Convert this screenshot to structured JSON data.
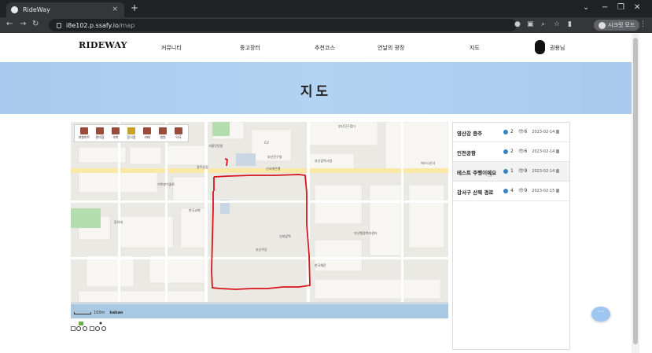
{
  "browser": {
    "tab_title": "RideWay",
    "tab_close": "×",
    "new_tab": "+",
    "url_host": "i8e102.p.ssafy.io",
    "url_path": "/map",
    "profile_label": "시크릿 모드",
    "window_controls": [
      "⌄",
      "−",
      "❐",
      "✕"
    ]
  },
  "header": {
    "logo": "RIDEWAY",
    "nav": [
      "커뮤니티",
      "중고장터",
      "추천코스",
      "연날의 광장",
      "지도"
    ],
    "username": "권용님"
  },
  "banner": {
    "title": "지도"
  },
  "map": {
    "toolbar": [
      "대형마트",
      "편의점",
      "숙박",
      "음식점",
      "카페",
      "병원",
      "약국"
    ],
    "labels": [
      "부산진구립다",
      "CU",
      "서울탄양원",
      "부산진구청",
      "신세계은행",
      "광주상점",
      "거북판기클로",
      "한국교회",
      "동의대",
      "신대앞역",
      "부산행정복지센터",
      "한국해운",
      "부산주당",
      "에스디산사",
      "부산광역시청"
    ],
    "scale_text": "100m",
    "scale_brand": "kakao"
  },
  "courses": [
    {
      "name": "영산강 종주",
      "likes": "2",
      "views": "6",
      "date": "2023-02-14"
    },
    {
      "name": "인천공항",
      "likes": "2",
      "views": "6",
      "date": "2023-02-14"
    },
    {
      "name": "테스트 주행이에요",
      "likes": "1",
      "views": "9",
      "date": "2023-02-14"
    },
    {
      "name": "강서구 산책 경로",
      "likes": "4",
      "views": "9",
      "date": "2023-02-15"
    }
  ],
  "chat": {
    "label": "···"
  },
  "colors": {
    "banner": "#a9c9ee",
    "route": "#d8141c",
    "chat": "#9ec6f0"
  }
}
